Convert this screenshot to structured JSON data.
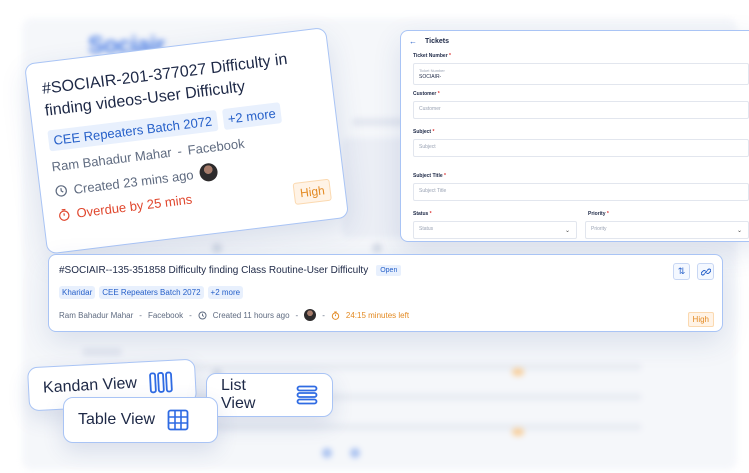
{
  "bg": {
    "logo": "Sociair"
  },
  "tilted_card": {
    "title": "#SOCIAIR-201-377027 Difficulty in finding videos-User Difficulty",
    "tags": [
      "CEE Repeaters Batch 2072",
      "+2 more"
    ],
    "author": "Ram Bahadur Mahar",
    "source": "Facebook",
    "created": "Created 23 mins ago",
    "priority": "High",
    "overdue": "Overdue by 25 mins"
  },
  "form": {
    "title": "Tickets",
    "ticket_number_label": "Ticket Number",
    "ticket_number_inner_label": "Ticket Number",
    "ticket_number_value": "SOCIAIR-",
    "customer_label": "Customer",
    "customer_placeholder": "Customer",
    "subject_label": "Subject",
    "subject_placeholder": "Subject",
    "subject_title_label": "Subject Title",
    "subject_title_placeholder": "Subject Title",
    "status_label": "Status",
    "status_placeholder": "Status",
    "priority_label": "Priority",
    "priority_placeholder": "Priority",
    "required_mark": "*"
  },
  "wide_card": {
    "title": "#SOCIAIR--135-351858 Difficulty finding Class Routine-User Difficulty",
    "status": "Open",
    "tags": [
      "Kharidar",
      "CEE Repeaters Batch 2072",
      "+2 more"
    ],
    "author": "Ram Bahadur Mahar",
    "source": "Facebook",
    "created": "Created 11 hours ago",
    "time_left": "24:15 minutes left",
    "priority": "High",
    "separator": "-"
  },
  "views": {
    "kanban": "Kandan View",
    "list": "List View",
    "table": "Table View"
  },
  "colors": {
    "accent": "#2660c9",
    "border": "#a9c4f5",
    "high": "#e38a23",
    "overdue": "#e0472e"
  }
}
